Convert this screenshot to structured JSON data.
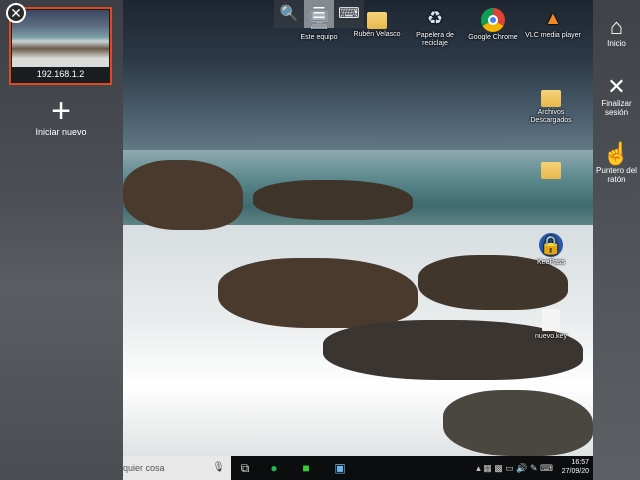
{
  "left_panel": {
    "session_label": "192.168.1.2",
    "close_icon": "close-icon",
    "new_session_icon": "+",
    "new_session_label": "Iniciar nuevo"
  },
  "toolbar": {
    "zoom_icon": "🔍",
    "menu_icon": "☰",
    "keyboard_icon": "⌨"
  },
  "desktop_icons": [
    {
      "label": "Este equipo",
      "icon": "computer-icon"
    },
    {
      "label": "Rubén Velasco",
      "icon": "user-folder-icon"
    },
    {
      "label": "Papelera de reciclaje",
      "icon": "recycle-bin-icon"
    },
    {
      "label": "Google Chrome",
      "icon": "chrome-icon"
    },
    {
      "label": "VLC media player",
      "icon": "vlc-icon"
    },
    {
      "label": "Archivos Descargados",
      "icon": "folder-shortcut-icon"
    },
    {
      "label": "",
      "icon": "folder-icon"
    },
    {
      "label": "KeePass",
      "icon": "keepass-icon"
    },
    {
      "label": "nuevo.key",
      "icon": "file-icon"
    }
  ],
  "taskbar": {
    "search_placeholder": "quier cosa",
    "time": "16:57",
    "date": "27/09/20"
  },
  "right_panel": [
    {
      "label": "Inicio",
      "icon": "home-icon"
    },
    {
      "label": "Finalizar sesión",
      "icon": "close-icon"
    },
    {
      "label": "Puntero del ratón",
      "icon": "hand-pointer-icon"
    }
  ]
}
